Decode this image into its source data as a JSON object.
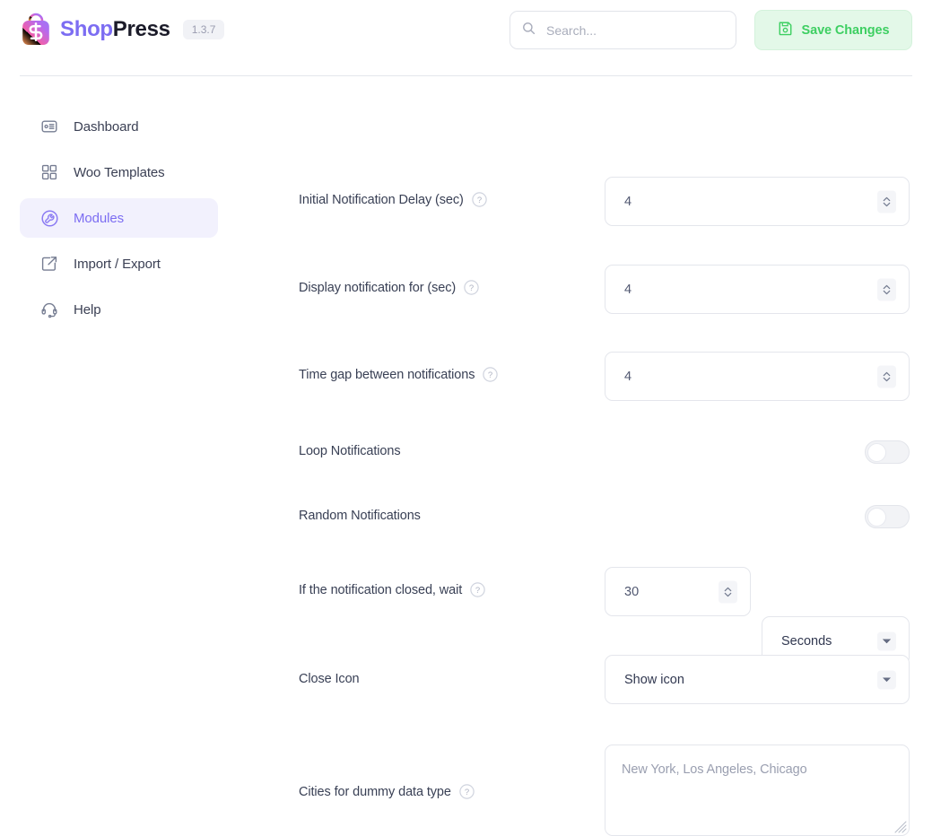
{
  "header": {
    "brand_shop": "Shop",
    "brand_press": "Press",
    "version": "1.3.7",
    "search_placeholder": "Search...",
    "search_value": "",
    "save_label": "Save Changes"
  },
  "sidebar": {
    "items": [
      {
        "label": "Dashboard",
        "icon": "dashboard-icon",
        "active": false
      },
      {
        "label": "Woo Templates",
        "icon": "grid-icon",
        "active": false
      },
      {
        "label": "Modules",
        "icon": "wrench-circle-icon",
        "active": true
      },
      {
        "label": "Import / Export",
        "icon": "export-box-icon",
        "active": false
      },
      {
        "label": "Help",
        "icon": "headset-icon",
        "active": false
      }
    ]
  },
  "form": {
    "fields": [
      {
        "label": "Initial Notification Delay (sec)",
        "help": true,
        "type": "number",
        "value": "4"
      },
      {
        "label": "Display notification for (sec)",
        "help": true,
        "type": "number",
        "value": "4"
      },
      {
        "label": "Time gap between notifications",
        "help": true,
        "type": "number",
        "value": "4"
      },
      {
        "label": "Loop Notifications",
        "help": false,
        "type": "toggle",
        "value": "off"
      },
      {
        "label": "Random Notifications",
        "help": false,
        "type": "toggle",
        "value": "off"
      },
      {
        "label": "If the notification closed, wait",
        "help": true,
        "type": "number-unit",
        "value": "30",
        "unit": "Seconds"
      },
      {
        "label": "Close Icon",
        "help": false,
        "type": "select",
        "value": "Show icon"
      },
      {
        "label": "Cities for dummy data type",
        "help": true,
        "type": "textarea",
        "value": "New York, Los Angeles, Chicago"
      }
    ]
  },
  "colors": {
    "accent_purple": "#7c6df2",
    "save_green": "#3ecf62",
    "save_green_bg": "#e3f8e8",
    "border": "#e4e6ec",
    "text": "#394055"
  }
}
